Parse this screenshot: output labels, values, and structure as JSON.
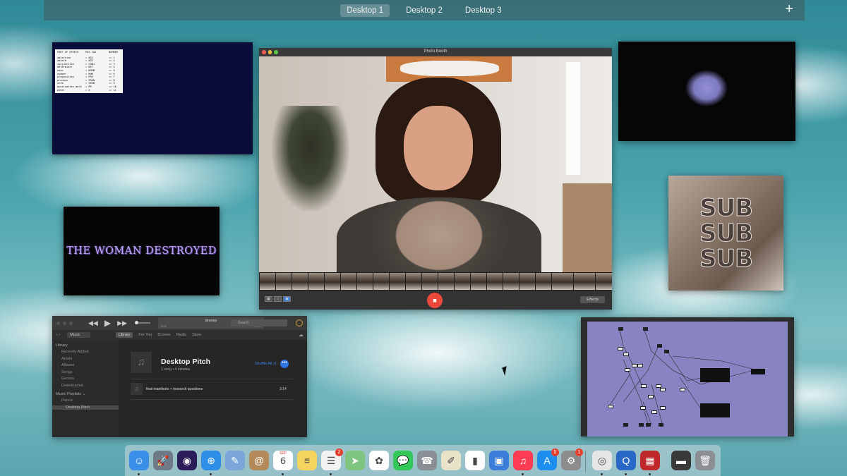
{
  "spaces": {
    "tabs": [
      "Desktop 1",
      "Desktop 2",
      "Desktop 3"
    ],
    "active": "Desktop 1",
    "add_label": "+"
  },
  "terminal": {
    "headers": [
      "PART OF SPEECH",
      "POS TAG",
      "NUMBER"
    ],
    "rows": [
      [
        "adjective",
        "= ADJ",
        "=> 1"
      ],
      [
        "adverb",
        "= ADV",
        "=> 2"
      ],
      [
        "conjunctive",
        "= CONJ",
        "=> 3"
      ],
      [
        "determiner",
        "= DET",
        "=> 4"
      ],
      [
        "noun",
        "= NOUN",
        "=> 5"
      ],
      [
        "number",
        "= NUM",
        "=> 6"
      ],
      [
        "preposition",
        "= PRE",
        "=> 7"
      ],
      [
        "pronoun",
        "= PRON",
        "=> 8"
      ],
      [
        "verb",
        "= VERB",
        "=> 9"
      ],
      [
        "punctuation mark",
        "= PM",
        "=> 10"
      ],
      [
        "other",
        "= X",
        "=> 11"
      ]
    ]
  },
  "woman": {
    "title": "THE WOMAN DESTROYED"
  },
  "music": {
    "now_playing": "droney",
    "time_elapsed": "0:00",
    "time_remaining": "-1:23",
    "search_placeholder": "Search",
    "source": "Music",
    "tabs": [
      "Library",
      "For You",
      "Browse",
      "Radio",
      "Store"
    ],
    "active_tab": "Library",
    "sidebar": {
      "library_heading": "Library",
      "library_items": [
        "Recently Added",
        "Artists",
        "Albums",
        "Songs",
        "Genres",
        "Downloaded"
      ],
      "playlists_heading": "Music Playlists ⌄",
      "playlists": [
        "Dance",
        "Desktop Pitch"
      ],
      "selected": "Desktop Pitch"
    },
    "playlist": {
      "title": "Desktop Pitch",
      "subtitle": "1 song • 4 minutes",
      "shuffle_label": "Shuffle All ⤮",
      "more_label": "•••"
    },
    "tracks": [
      {
        "title": "final manifesto + research questions",
        "duration": "3:14"
      }
    ]
  },
  "photobooth": {
    "title": "Photo Booth",
    "effects_label": "Effects",
    "thumbnail_count": 22
  },
  "subwindow": {
    "words": [
      "SUB",
      "SUB",
      "SUB"
    ]
  },
  "dock": {
    "apps": [
      {
        "name": "finder-icon",
        "color": "#3c8fe8",
        "glyph": "☺"
      },
      {
        "name": "launchpad-icon",
        "color": "#6e7a86",
        "glyph": "🚀"
      },
      {
        "name": "siri-icon",
        "color": "#2a1d5a",
        "glyph": "◉"
      },
      {
        "name": "safari-icon",
        "color": "#2f8ee8",
        "glyph": "⊕"
      },
      {
        "name": "preview-icon",
        "color": "#7aa7d8",
        "glyph": "✎"
      },
      {
        "name": "contacts-icon",
        "color": "#b58a5a",
        "glyph": "@"
      },
      {
        "name": "calendar-icon",
        "color": "#ffffff",
        "glyph": "6",
        "label": "SEP"
      },
      {
        "name": "notes-icon",
        "color": "#f4d35e",
        "glyph": "≡"
      },
      {
        "name": "reminders-icon",
        "color": "#f2f2f2",
        "glyph": "☰",
        "badge": "2"
      },
      {
        "name": "maps-icon",
        "color": "#7fc57f",
        "glyph": "➤"
      },
      {
        "name": "photos-icon",
        "color": "#ffffff",
        "glyph": "✿"
      },
      {
        "name": "messages-icon",
        "color": "#34c759",
        "glyph": "💬"
      },
      {
        "name": "facetime-icon",
        "color": "#8a8f96",
        "glyph": "☎"
      },
      {
        "name": "textedit-icon",
        "color": "#e9e2c9",
        "glyph": "✐"
      },
      {
        "name": "numbers-icon",
        "color": "#ffffff",
        "glyph": "▮"
      },
      {
        "name": "keynote-icon",
        "color": "#3b7dd8",
        "glyph": "▣"
      },
      {
        "name": "music-icon",
        "color": "#fb3c52",
        "glyph": "♫"
      },
      {
        "name": "app-store-icon",
        "color": "#1d8ef0",
        "glyph": "A",
        "badge": "5"
      },
      {
        "name": "system-preferences-icon",
        "color": "#8c8c8c",
        "glyph": "⚙",
        "badge": "1"
      },
      {
        "name": "chrome-icon",
        "color": "#e6e6e6",
        "glyph": "◎"
      },
      {
        "name": "quicktime-icon",
        "color": "#2a68c8",
        "glyph": "Q"
      },
      {
        "name": "photo-booth-icon",
        "color": "#c0282b",
        "glyph": "▦"
      },
      {
        "name": "screen-icon",
        "color": "#3a3a3a",
        "glyph": "▬"
      },
      {
        "name": "trash-icon",
        "color": "#8b8f93",
        "glyph": "🗑"
      }
    ],
    "calendar_month": "SEP"
  },
  "colors": {
    "accent_blue": "#3b84ea",
    "record_red": "#e8493b",
    "patch_bg": "#8883c3",
    "terminal_bg": "#0a0d3a"
  }
}
